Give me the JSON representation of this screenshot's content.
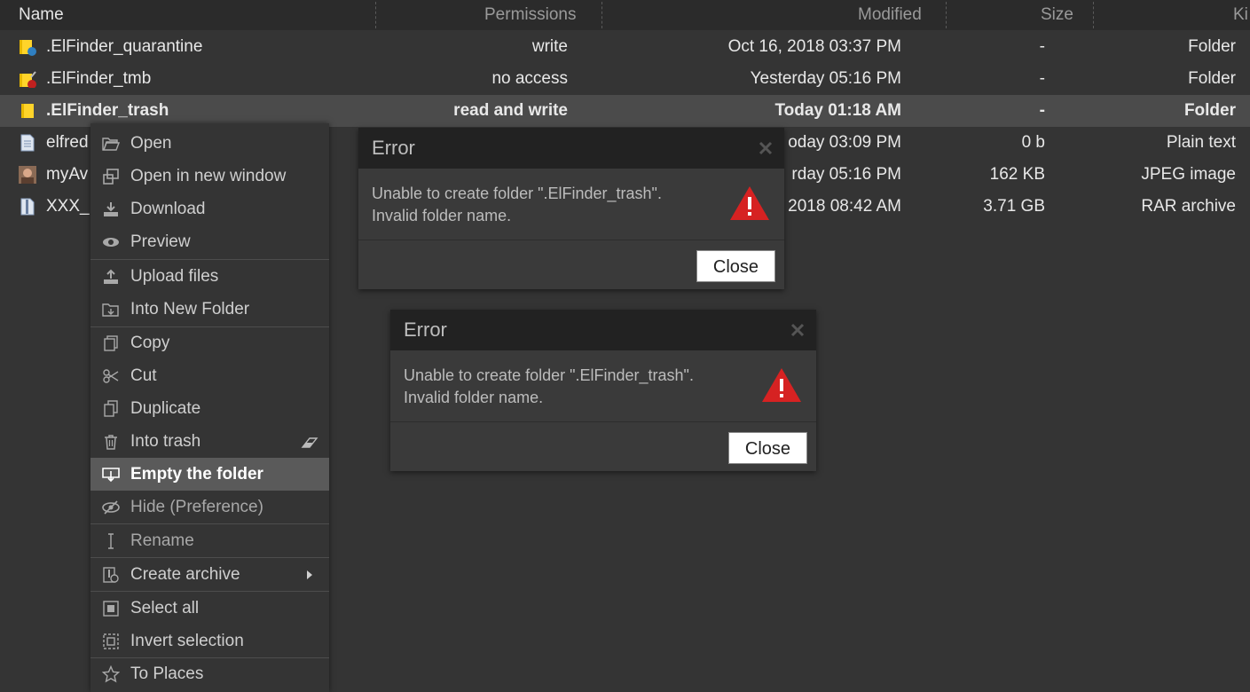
{
  "columns": {
    "name": "Name",
    "permissions": "Permissions",
    "modified": "Modified",
    "size": "Size",
    "kind": "Ki"
  },
  "files": [
    {
      "name": ".ElFinder_quarantine",
      "permissions": "write",
      "modified": "Oct 16, 2018 03:37 PM",
      "size": "-",
      "kind": "Folder",
      "icon": "folder-write-only-icon"
    },
    {
      "name": ".ElFinder_tmb",
      "permissions": "no access",
      "modified": "Yesterday 05:16 PM",
      "size": "-",
      "kind": "Folder",
      "icon": "folder-no-access-icon"
    },
    {
      "name": ".ElFinder_trash",
      "permissions": "read and write",
      "modified": "Today 01:18 AM",
      "size": "-",
      "kind": "Folder",
      "icon": "folder-icon",
      "selected": true
    },
    {
      "name": "elfred",
      "permissions": "",
      "modified": "oday 03:09 PM",
      "size": "0 b",
      "kind": "Plain text",
      "icon": "text-file-icon"
    },
    {
      "name": "myAv",
      "permissions": "",
      "modified": "rday 05:16 PM",
      "size": "162 KB",
      "kind": "JPEG image",
      "icon": "image-thumbnail-icon"
    },
    {
      "name": "XXX_",
      "permissions": "",
      "modified": "2018 08:42 AM",
      "size": "3.71 GB",
      "kind": "RAR archive",
      "icon": "archive-file-icon"
    }
  ],
  "context_menu": {
    "items": [
      {
        "label": "Open",
        "icon": "folder-open-icon"
      },
      {
        "label": "Open in new window",
        "icon": "new-window-icon"
      },
      {
        "label": "Download",
        "icon": "download-icon"
      },
      {
        "label": "Preview",
        "icon": "eye-icon"
      },
      {
        "label": "Upload files",
        "icon": "upload-icon"
      },
      {
        "label": "Into New Folder",
        "icon": "into-folder-icon"
      },
      {
        "label": "Copy",
        "icon": "copy-icon"
      },
      {
        "label": "Cut",
        "icon": "scissors-icon"
      },
      {
        "label": "Duplicate",
        "icon": "duplicate-icon"
      },
      {
        "label": "Into trash",
        "icon": "trash-icon"
      },
      {
        "label": "Empty the folder",
        "icon": "empty-folder-icon",
        "active": true
      },
      {
        "label": "Hide (Preference)",
        "icon": "eye-slash-icon"
      },
      {
        "label": "Rename",
        "icon": "text-cursor-icon"
      },
      {
        "label": "Create archive",
        "icon": "archive-icon"
      },
      {
        "label": "Select all",
        "icon": "select-all-icon"
      },
      {
        "label": "Invert selection",
        "icon": "invert-selection-icon"
      },
      {
        "label": "To Places",
        "icon": "star-icon"
      }
    ]
  },
  "dialogs": [
    {
      "title": "Error",
      "message_line1": "Unable to create folder \".ElFinder_trash\".",
      "message_line2": "Invalid folder name.",
      "button": "Close"
    },
    {
      "title": "Error",
      "message_line1": "Unable to create folder \".ElFinder_trash\".",
      "message_line2": "Invalid folder name.",
      "button": "Close"
    }
  ],
  "colors": {
    "background": "#343434",
    "selected_row": "#4b4b4b",
    "folder": "#ffd42a",
    "warning": "#d62222"
  }
}
